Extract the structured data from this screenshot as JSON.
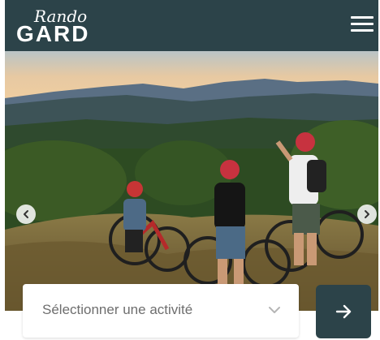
{
  "header": {
    "logo_script": "Rando",
    "logo_main": "GARD",
    "menu_icon": "hamburger-menu-icon"
  },
  "hero": {
    "prev_icon": "chevron-left-icon",
    "next_icon": "chevron-right-icon"
  },
  "search": {
    "activity_placeholder": "Sélectionner une activité",
    "dropdown_icon": "chevron-down-icon",
    "submit_icon": "arrow-right-icon"
  },
  "colors": {
    "header_bg": "#2c4349",
    "button_bg": "#2c4349"
  }
}
